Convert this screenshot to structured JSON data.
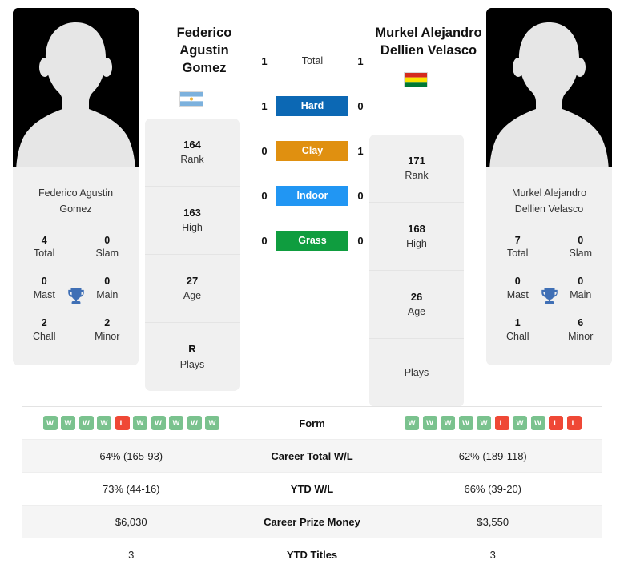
{
  "players": {
    "left": {
      "display_name_lines": [
        "Federico",
        "Agustin",
        "Gomez"
      ],
      "full_name_lines": [
        "Federico Agustin",
        "Gomez"
      ],
      "flag_name": "argentina-flag",
      "titles": [
        {
          "num": "4",
          "label": "Total"
        },
        {
          "num": "0",
          "label": "Slam"
        },
        {
          "num": "0",
          "label": "Mast"
        },
        {
          "num": "0",
          "label": "Main"
        },
        {
          "num": "2",
          "label": "Chall"
        },
        {
          "num": "2",
          "label": "Minor"
        }
      ],
      "info": [
        {
          "num": "164",
          "label": "Rank"
        },
        {
          "num": "163",
          "label": "High"
        },
        {
          "num": "27",
          "label": "Age"
        },
        {
          "num": "R",
          "label": "Plays"
        }
      ],
      "form": [
        "W",
        "W",
        "W",
        "W",
        "L",
        "W",
        "W",
        "W",
        "W",
        "W"
      ],
      "career_total_wl": "64% (165-93)",
      "ytd_wl": "73% (44-16)",
      "career_prize_money": "$6,030",
      "ytd_titles": "3"
    },
    "right": {
      "display_name_lines": [
        "Murkel Alejandro",
        "Dellien Velasco"
      ],
      "full_name_lines": [
        "Murkel Alejandro",
        "Dellien Velasco"
      ],
      "flag_name": "bolivia-flag",
      "titles": [
        {
          "num": "7",
          "label": "Total"
        },
        {
          "num": "0",
          "label": "Slam"
        },
        {
          "num": "0",
          "label": "Mast"
        },
        {
          "num": "0",
          "label": "Main"
        },
        {
          "num": "1",
          "label": "Chall"
        },
        {
          "num": "6",
          "label": "Minor"
        }
      ],
      "info": [
        {
          "num": "171",
          "label": "Rank"
        },
        {
          "num": "168",
          "label": "High"
        },
        {
          "num": "26",
          "label": "Age"
        },
        {
          "num": "",
          "label": "Plays"
        }
      ],
      "form": [
        "W",
        "W",
        "W",
        "W",
        "W",
        "L",
        "W",
        "W",
        "L",
        "L"
      ],
      "career_total_wl": "62% (189-118)",
      "ytd_wl": "66% (39-20)",
      "career_prize_money": "$3,550",
      "ytd_titles": "3"
    }
  },
  "surfaces": [
    {
      "label": "Total",
      "left": "1",
      "right": "1",
      "color": ""
    },
    {
      "label": "Hard",
      "left": "1",
      "right": "0",
      "color": "#0c68b4"
    },
    {
      "label": "Clay",
      "left": "0",
      "right": "1",
      "color": "#e09010"
    },
    {
      "label": "Indoor",
      "left": "0",
      "right": "0",
      "color": "#2196f3"
    },
    {
      "label": "Grass",
      "left": "0",
      "right": "0",
      "color": "#0f9d3f"
    }
  ],
  "stats_rows": [
    {
      "label": "Form",
      "key": "form"
    },
    {
      "label": "Career Total W/L",
      "key": "career_total_wl"
    },
    {
      "label": "YTD W/L",
      "key": "ytd_wl"
    },
    {
      "label": "Career Prize Money",
      "key": "career_prize_money"
    },
    {
      "label": "YTD Titles",
      "key": "ytd_titles"
    }
  ],
  "colors": {
    "win_badge": "#7ac28e",
    "loss_badge": "#ef4836",
    "card_bg": "#f0f0f0",
    "trophy": "#3f6fb5"
  }
}
